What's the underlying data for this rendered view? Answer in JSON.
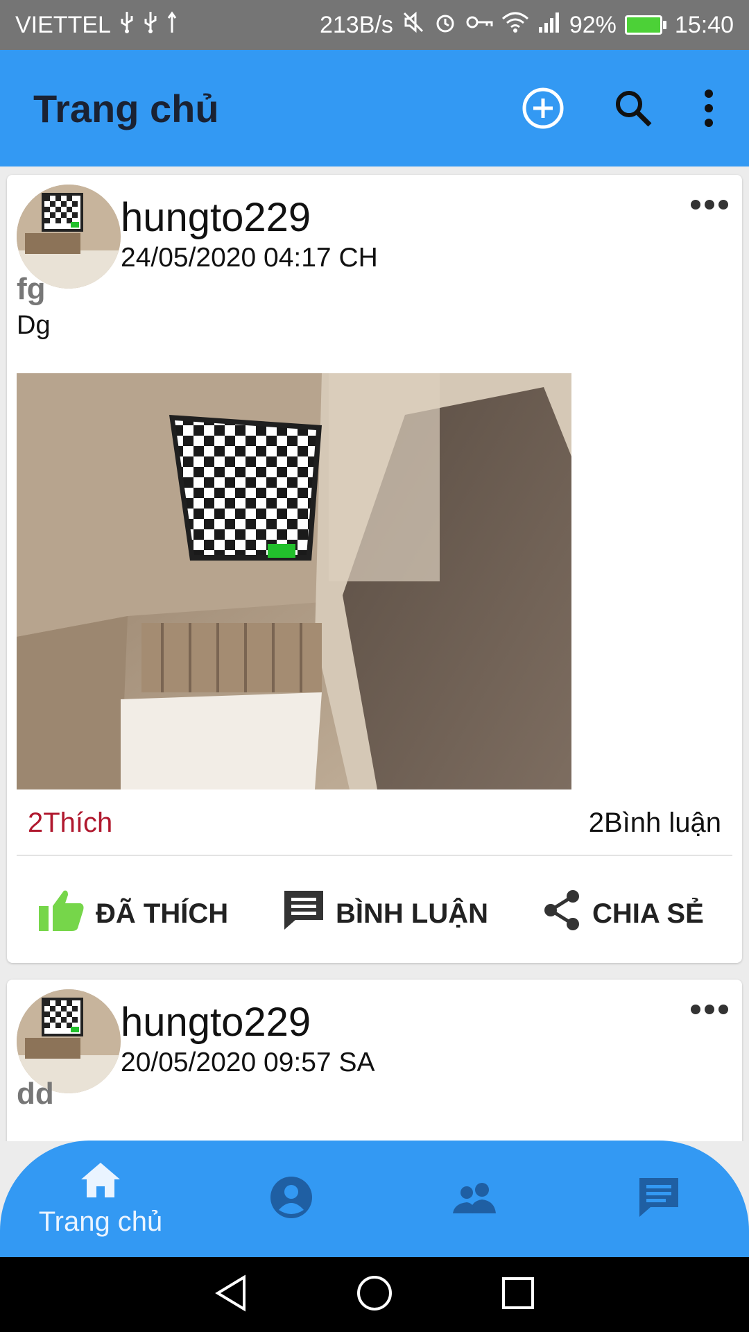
{
  "status_bar": {
    "carrier": "VIETTEL",
    "network_speed": "213B/s",
    "battery": "92%",
    "time": "15:40"
  },
  "app_bar": {
    "title": "Trang chủ",
    "icons": [
      "add-circle-icon",
      "search-icon",
      "more-vertical-icon"
    ]
  },
  "posts": [
    {
      "author": "hungto229",
      "timestamp": "24/05/2020 04:17 CH",
      "title": "fg",
      "body": "Dg",
      "likes": "2Thích",
      "comments": "2Bình luận",
      "liked": true
    },
    {
      "author": "hungto229",
      "timestamp": "20/05/2020 09:57 SA",
      "title": "dd"
    }
  ],
  "actions": {
    "like": "ĐÃ THÍCH",
    "comment": "BÌNH LUẬN",
    "share": "CHIA SẺ"
  },
  "bottom_nav": {
    "home_label": "Trang chủ",
    "items": [
      "home-icon",
      "account-circle-icon",
      "people-icon",
      "chat-icon"
    ]
  },
  "colors": {
    "primary": "#3399f3",
    "liked_green": "#76d64a",
    "likes_text": "#b0182e"
  }
}
